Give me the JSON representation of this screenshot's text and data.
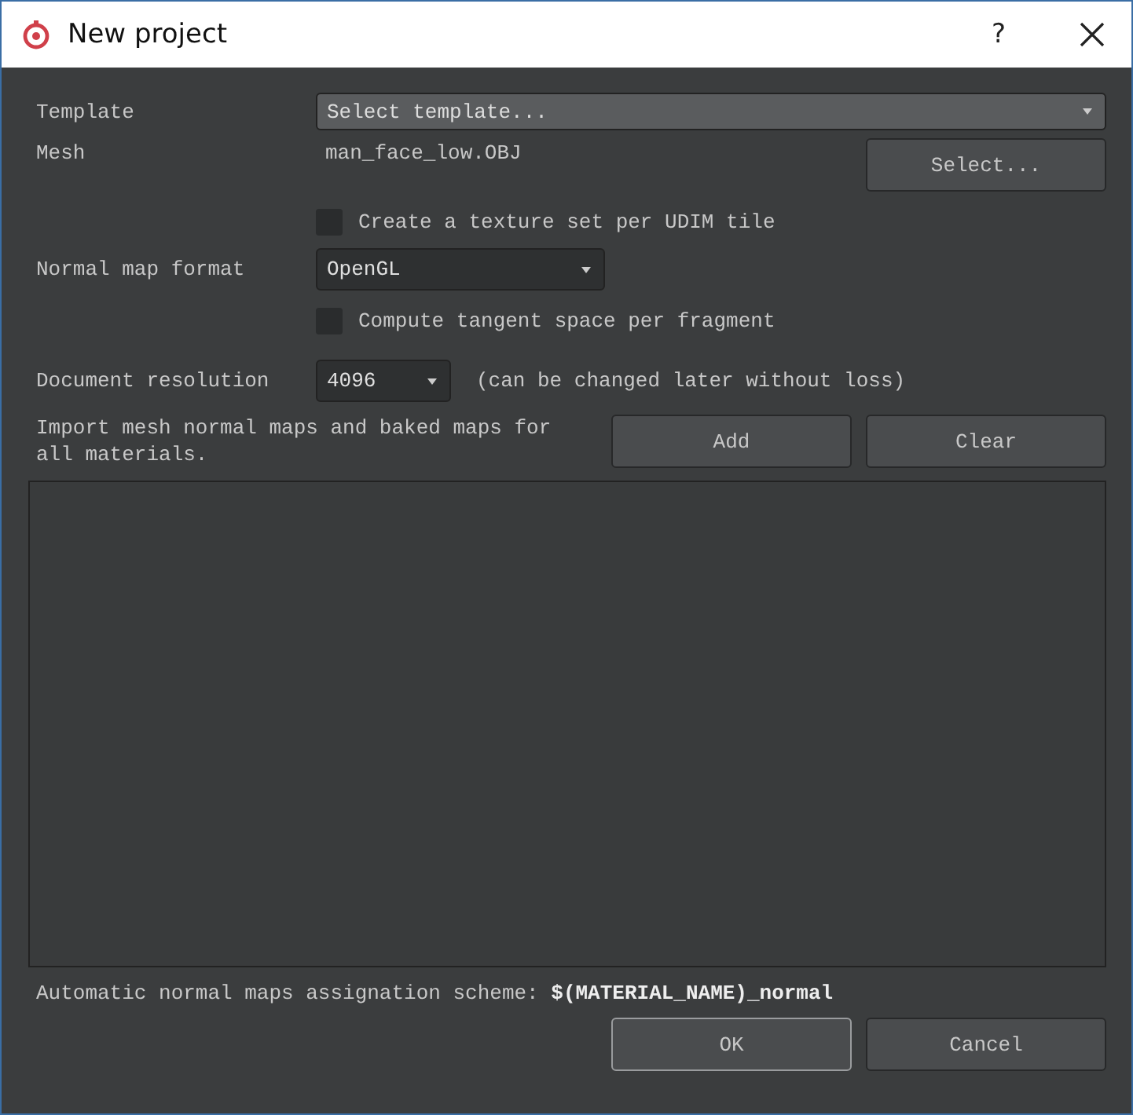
{
  "window": {
    "title": "New project",
    "help": "?"
  },
  "template": {
    "label": "Template",
    "placeholder": "Select template..."
  },
  "mesh": {
    "label": "Mesh",
    "value": "man_face_low.OBJ",
    "button": "Select..."
  },
  "udim": {
    "label": "Create a texture set per UDIM tile",
    "checked": false
  },
  "normal_map_format": {
    "label": "Normal map format",
    "value": "OpenGL"
  },
  "tangent": {
    "label": "Compute tangent space per fragment",
    "checked": false
  },
  "document_resolution": {
    "label": "Document resolution",
    "value": "4096",
    "note": "(can be changed later without loss)"
  },
  "import": {
    "text": "Import mesh normal maps and baked maps for all materials.",
    "buttons": [
      "Add",
      "Clear"
    ]
  },
  "scheme": {
    "label": "Automatic normal maps assignation scheme:",
    "value": "$(MATERIAL_NAME)_normal"
  },
  "buttons": [
    {
      "label": "OK",
      "default": true
    },
    {
      "label": "Cancel",
      "default": false
    }
  ]
}
